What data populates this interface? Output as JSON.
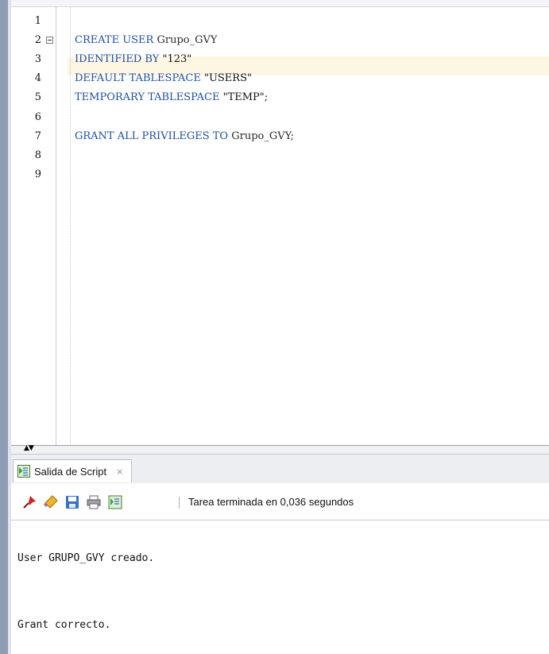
{
  "editor": {
    "lines": [
      {
        "num": "1",
        "segments": []
      },
      {
        "num": "2",
        "foldable": true,
        "segments": [
          {
            "t": "CREATE USER ",
            "c": "kw"
          },
          {
            "t": "Grupo_GVY",
            "c": "id"
          }
        ]
      },
      {
        "num": "3",
        "segments": [
          {
            "t": "IDENTIFIED BY ",
            "c": "kw"
          },
          {
            "t": "\"123\"",
            "c": "str"
          }
        ]
      },
      {
        "num": "4",
        "segments": [
          {
            "t": "DEFAULT TABLESPACE ",
            "c": "kw"
          },
          {
            "t": "\"USERS\"",
            "c": "str"
          }
        ]
      },
      {
        "num": "5",
        "segments": [
          {
            "t": "TEMPORARY TABLESPACE ",
            "c": "kw"
          },
          {
            "t": "\"TEMP\";",
            "c": "str"
          }
        ]
      },
      {
        "num": "6",
        "segments": []
      },
      {
        "num": "7",
        "segments": [
          {
            "t": "GRANT ALL PRIVILEGES TO ",
            "c": "kw"
          },
          {
            "t": "Grupo_GVY;",
            "c": "id"
          }
        ]
      },
      {
        "num": "8",
        "segments": []
      },
      {
        "num": "9",
        "segments": []
      }
    ]
  },
  "output_panel": {
    "tab_label": "Salida de Script",
    "tab_close": "×",
    "status": "Tarea terminada en 0,036 segundos",
    "lines": [
      "User GRUPO_GVY creado.",
      "Grant correcto."
    ]
  },
  "splitter": {
    "arrows": "▲▼"
  },
  "icons": {
    "script_output": "script-output-icon",
    "pin": "pin-icon",
    "eraser": "eraser-icon",
    "save": "save-icon",
    "print": "print-icon",
    "run_script": "run-script-icon"
  },
  "colors": {
    "keyword": "#1d4ea3",
    "current_line": "#fdf6e3",
    "window_edge": "#8d9db4"
  }
}
